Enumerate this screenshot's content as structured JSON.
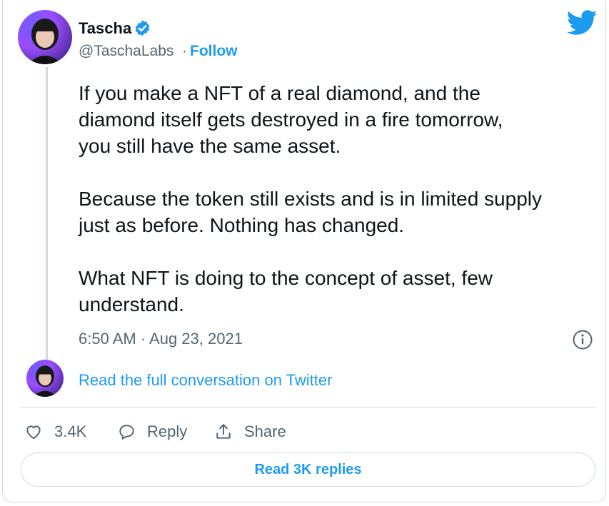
{
  "author": {
    "name": "Tascha",
    "handle": "@TaschaLabs",
    "separator": "·",
    "follow_label": "Follow",
    "verified": true
  },
  "tweet": {
    "text": "If you make a NFT of a real diamond, and the\ndiamond itself gets destroyed in a fire tomorrow,\nyou still have the same asset.\n\nBecause the token still exists and is in limited supply\njust as before. Nothing has changed.\n\nWhat NFT is doing to the concept of asset, few\nunderstand.",
    "timestamp": "6:50 AM · Aug 23, 2021"
  },
  "conversation": {
    "read_full_label": "Read the full conversation on Twitter"
  },
  "actions": {
    "like_count": "3.4K",
    "reply_label": "Reply",
    "share_label": "Share"
  },
  "footer": {
    "read_replies_label": "Read 3K replies"
  },
  "icons": {
    "verified": "verified-badge-icon",
    "brand": "twitter-bird-icon",
    "info": "info-icon",
    "like": "heart-icon",
    "reply": "speech-bubble-icon",
    "share": "share-upload-icon"
  },
  "colors": {
    "accent": "#1d9bf0",
    "muted_text": "#536471",
    "border": "#cfd9de",
    "text": "#0f1419"
  }
}
